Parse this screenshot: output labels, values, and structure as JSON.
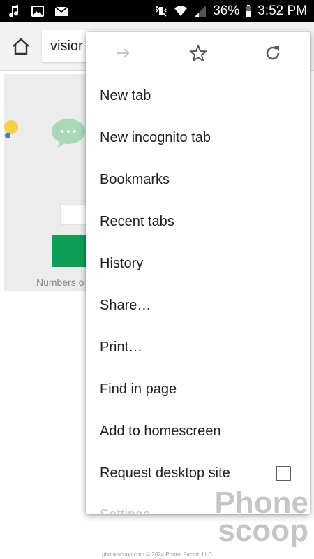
{
  "status_bar": {
    "battery_percent": "36%",
    "time": "3:52 PM",
    "icons_left": [
      "music-note-icon",
      "image-icon",
      "mail-icon"
    ],
    "icons_right": [
      "vibrate-mute-icon",
      "wifi-icon",
      "signal-icon",
      "battery-icon"
    ]
  },
  "toolbar": {
    "url_text": "visior",
    "home_icon": "home-icon"
  },
  "page_behind": {
    "caption": "Numbers o"
  },
  "menu": {
    "icons": [
      "forward-icon",
      "star-icon",
      "refresh-icon"
    ],
    "items": [
      {
        "label": "New tab"
      },
      {
        "label": "New incognito tab"
      },
      {
        "label": "Bookmarks"
      },
      {
        "label": "Recent tabs"
      },
      {
        "label": "History"
      },
      {
        "label": "Share…"
      },
      {
        "label": "Print…"
      },
      {
        "label": "Find in page"
      },
      {
        "label": "Add to homescreen"
      },
      {
        "label": "Request desktop site",
        "checkbox": false
      },
      {
        "label": "Settings"
      }
    ]
  },
  "watermark": {
    "line1": "Phone",
    "line2": "scoop",
    "credit": "phonescoop.com  © 2024 Phone Factor, LLC"
  },
  "colors": {
    "status_bar_bg": "#000000",
    "toolbar_bg": "#f2f2f2",
    "accent_green": "#0f9d58",
    "menu_text": "#212121"
  }
}
